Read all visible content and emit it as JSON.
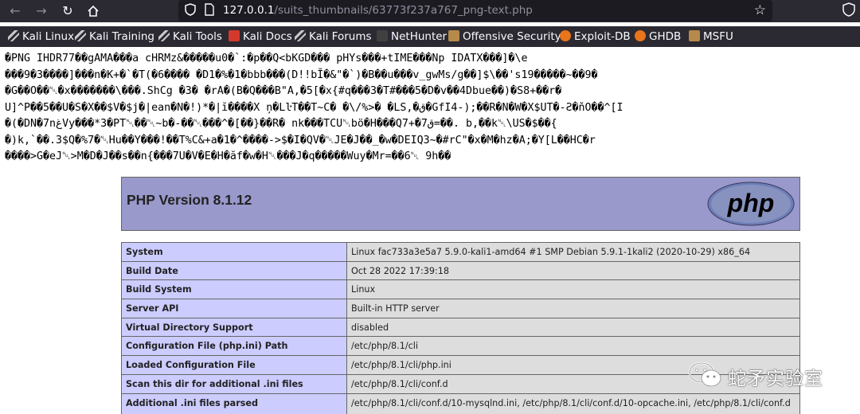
{
  "browser": {
    "url_host": "127.0.0.1",
    "url_path": "/suits_thumbnails/63773f237a767_png-text.php",
    "nav_icons": [
      "back-arrow-icon",
      "forward-arrow-icon",
      "reload-icon",
      "home-icon"
    ]
  },
  "bookmarks": [
    {
      "label": "Kali Linux",
      "icon": "kali-dragon-icon"
    },
    {
      "label": "Kali Training",
      "icon": "kali-dragon-icon"
    },
    {
      "label": "Kali Tools",
      "icon": "kali-dragon-icon"
    },
    {
      "label": "Kali Docs",
      "icon": "kali-docs-icon"
    },
    {
      "label": "Kali Forums",
      "icon": "kali-dragon-icon"
    },
    {
      "label": "NetHunter",
      "icon": "nethunter-icon"
    },
    {
      "label": "Offensive Security",
      "icon": "offsec-icon"
    },
    {
      "label": "Exploit-DB",
      "icon": "exploitdb-icon"
    },
    {
      "label": "GHDB",
      "icon": "ghdb-icon"
    },
    {
      "label": "MSFU",
      "icon": "msfu-icon"
    }
  ],
  "garbled_lines": [
    "�PNG  IHDR77��gAMA���a cHRMz&�����u0�`:�p��Q<bKGD��� pHYs���+tIME���Np IDATX���]�\\e",
    "���9�3����]���n�K+�`�T(�6���� �D1�%�1�bbb���(D!!bĬ�&\"�`)�B��u���v_gwMs/g��]$\\��'s19�����~��9�",
    "�G��O��␀�x�������\\���.ShCg �3� �rA�(B�Q���B\"A,�5[�x{#q���3�T#���5�D�v��4Dbue��)�S8+��r�",
    "U]^P��5��U�S�X��$V�$j�|ean�N�!)*�|ĭ����X ņ�LŀT��T~C� �\\/%>� �LS,�ق�GfI4-);��R�N�W�X$UT�-Ƨ�ňO��^[I",
    "�(�DN�7nغVy���*3�PT␀��␀~b�-��␀���^�[��}��R� nk���TCU␀bö�H���Q7+�7ق=��. b,��k␀\\US�$��{",
    "�)k,`��.3$Q�%7�␀Hu��Y���!��T%C&+a�1�^����->$�I�QV�␀JE�J��_�w�DEIQ3~�#rC\"�x�M�hz�A;�Y[L��HC�r",
    "����>G�eJ␀>M�D�J��s��n{���7U�V�E�H�ăf�w�H␀���J�q�����Wuy�Mr=��6␀ 9h��"
  ],
  "php": {
    "version_title": "PHP Version 8.1.12",
    "logo_text": "php"
  },
  "info_rows": [
    {
      "key": "System",
      "value": "Linux fac733a3e5a7 5.9.0-kali1-amd64 #1 SMP Debian 5.9.1-1kali2 (2020-10-29) x86_64"
    },
    {
      "key": "Build Date",
      "value": "Oct 28 2022 17:39:18"
    },
    {
      "key": "Build System",
      "value": "Linux"
    },
    {
      "key": "Server API",
      "value": "Built-in HTTP server"
    },
    {
      "key": "Virtual Directory Support",
      "value": "disabled"
    },
    {
      "key": "Configuration File (php.ini) Path",
      "value": "/etc/php/8.1/cli"
    },
    {
      "key": "Loaded Configuration File",
      "value": "/etc/php/8.1/cli/php.ini"
    },
    {
      "key": "Scan this dir for additional .ini files",
      "value": "/etc/php/8.1/cli/conf.d"
    },
    {
      "key": "Additional .ini files parsed",
      "value": "/etc/php/8.1/cli/conf.d/10-mysqlnd.ini, /etc/php/8.1/cli/conf.d/10-opcache.ini, /etc/php/8.1/cli/conf.d"
    }
  ],
  "watermark": "蛇矛实验室",
  "colors": {
    "chrome_bg": "#2b2a33",
    "php_header": "#9999cc",
    "php_key": "#ccccff",
    "php_val": "#dddddd"
  }
}
